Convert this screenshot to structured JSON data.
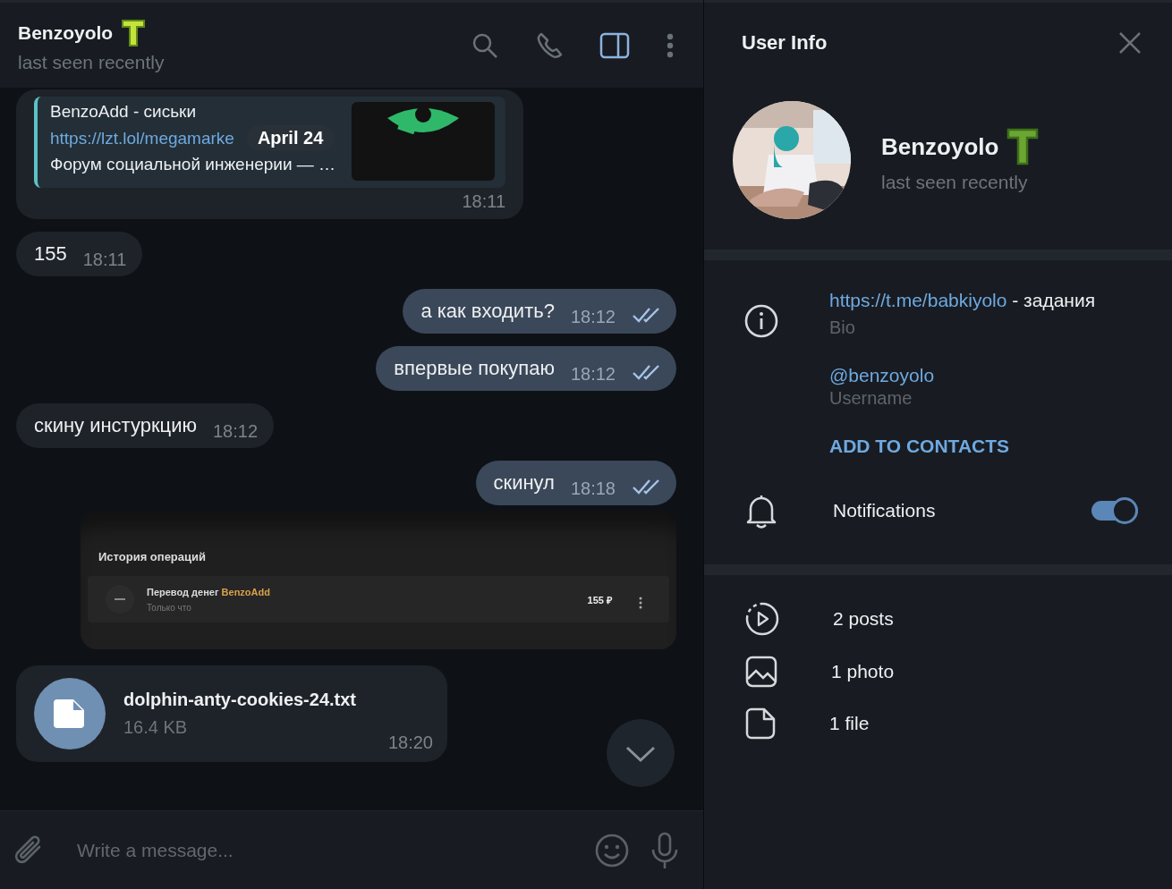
{
  "chat_header": {
    "name": "Benzoyolo",
    "status": "last seen recently"
  },
  "date_pill": "April 24",
  "messages": [
    {
      "kind": "link_preview",
      "outgoing": false,
      "preview_title": "BenzoAdd - сиськи",
      "link": "https://lzt.lol/megamarke",
      "description": "Форум социальной инженерии —  …",
      "time": "18:11"
    },
    {
      "kind": "text",
      "outgoing": false,
      "text": "155",
      "time": "18:11"
    },
    {
      "kind": "text",
      "outgoing": true,
      "text": "а как входить?",
      "time": "18:12",
      "read": true
    },
    {
      "kind": "text",
      "outgoing": true,
      "text": "впервые покупаю",
      "time": "18:12",
      "read": true
    },
    {
      "kind": "text",
      "outgoing": false,
      "text": "скину инстуркцию",
      "time": "18:12"
    },
    {
      "kind": "text",
      "outgoing": true,
      "text": "скинул",
      "time": "18:18",
      "read": true
    },
    {
      "kind": "screenshot",
      "outgoing": true,
      "heading": "История операций",
      "operation": "Перевод денег",
      "payee": "BenzoAdd",
      "when": "Только что",
      "amount": "155 ₽"
    },
    {
      "kind": "file",
      "outgoing": false,
      "filename": "dolphin-anty-cookies-24.txt",
      "size": "16.4 KB",
      "time": "18:20"
    }
  ],
  "composer": {
    "placeholder": "Write a message..."
  },
  "info_panel": {
    "title": "User Info",
    "name": "Benzoyolo",
    "status": "last seen recently",
    "bio_link": "https://t.me/babkiyolo",
    "bio_rest": " - задания",
    "bio_label": "Bio",
    "username": "@benzoyolo",
    "username_label": "Username",
    "add_contact": "ADD TO CONTACTS",
    "notifications": {
      "label": "Notifications",
      "on": true
    },
    "media": [
      {
        "kind": "posts",
        "label": "2 posts"
      },
      {
        "kind": "photos",
        "label": "1 photo"
      },
      {
        "kind": "files",
        "label": "1 file"
      }
    ]
  }
}
